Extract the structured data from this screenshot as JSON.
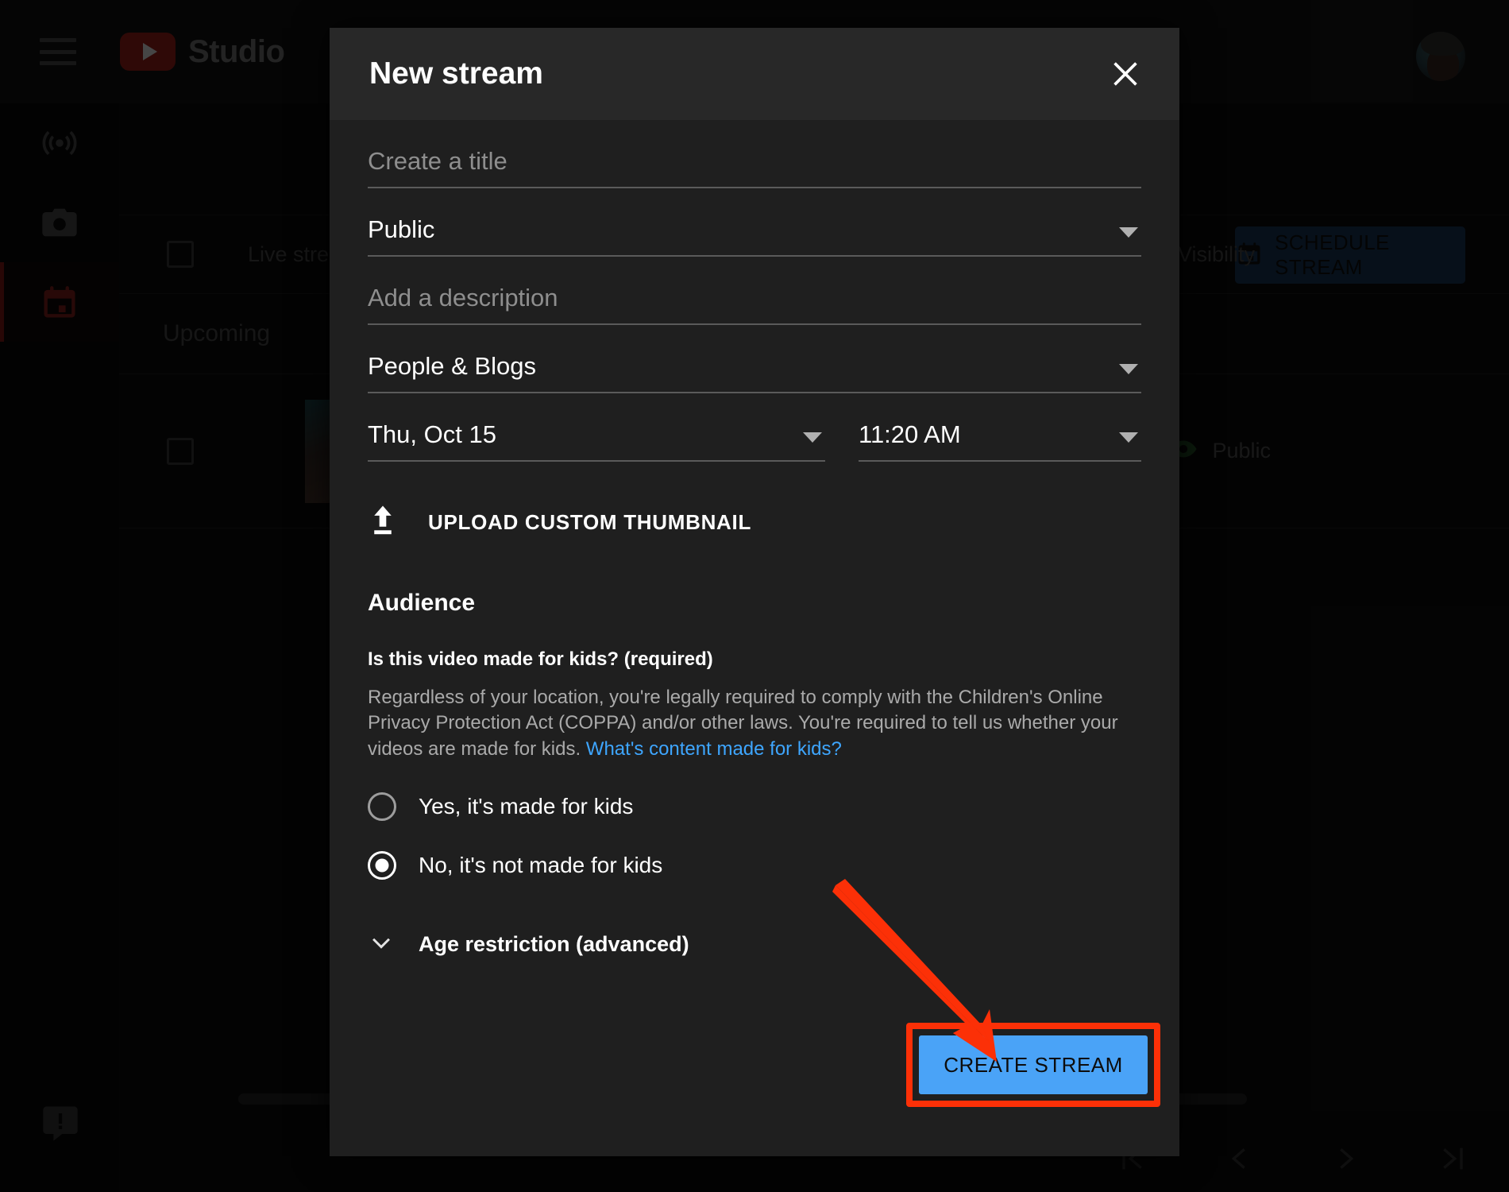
{
  "app": {
    "brand": "Studio",
    "logo_icon": "youtube-logo-icon",
    "menu_icon": "hamburger-menu-icon",
    "avatar_alt": "account-avatar"
  },
  "left_rail": [
    {
      "icon": "live-broadcast-icon",
      "name": "live-streaming",
      "active": false
    },
    {
      "icon": "camera-icon",
      "name": "webcam",
      "active": false
    },
    {
      "icon": "calendar-icon",
      "name": "manage-scheduled",
      "active": true
    }
  ],
  "background": {
    "table_header_label": "Live stream",
    "visibility_header": "Visibility",
    "section_label": "Upcoming",
    "visibility_value": "Public",
    "visibility_icon": "eye-icon",
    "schedule_button": "SCHEDULE STREAM",
    "schedule_button_icon": "calendar-icon",
    "feedback_icon": "feedback-icon",
    "live_badge_icon": "live-signal-icon",
    "pager": [
      {
        "name": "first-page",
        "icon": "first-page-icon"
      },
      {
        "name": "previous-page",
        "icon": "chevron-left-icon"
      },
      {
        "name": "next-page",
        "icon": "chevron-right-icon"
      },
      {
        "name": "last-page",
        "icon": "last-page-icon"
      }
    ]
  },
  "modal": {
    "title": "New stream",
    "close_icon": "close-icon",
    "title_field": {
      "placeholder": "Create a title",
      "value": ""
    },
    "visibility_select": {
      "value": "Public",
      "caret_icon": "chevron-down-icon"
    },
    "description_field": {
      "placeholder": "Add a description",
      "value": ""
    },
    "category_select": {
      "value": "People & Blogs",
      "caret_icon": "chevron-down-icon"
    },
    "date_select": {
      "value": "Thu, Oct 15",
      "caret_icon": "chevron-down-icon"
    },
    "time_select": {
      "value": "11:20 AM",
      "caret_icon": "chevron-down-icon"
    },
    "upload_thumbnail": {
      "label": "UPLOAD CUSTOM THUMBNAIL",
      "icon": "upload-icon"
    },
    "audience": {
      "heading": "Audience",
      "question": "Is this video made for kids? (required)",
      "description": "Regardless of your location, you're legally required to comply with the Children's Online Privacy Protection Act (COPPA) and/or other laws. You're required to tell us whether your videos are made for kids. ",
      "link_text": "What's content made for kids?",
      "options": [
        {
          "label": "Yes, it's made for kids",
          "selected": false
        },
        {
          "label": "No, it's not made for kids",
          "selected": true
        }
      ]
    },
    "age_restriction": {
      "label": "Age restriction (advanced)",
      "icon": "chevron-down-icon"
    },
    "create_button": "CREATE STREAM"
  },
  "annotation": {
    "arrow_icon": "red-arrow-pointer",
    "highlight_color": "#fc3007",
    "button_color": "#4aa3f7"
  }
}
